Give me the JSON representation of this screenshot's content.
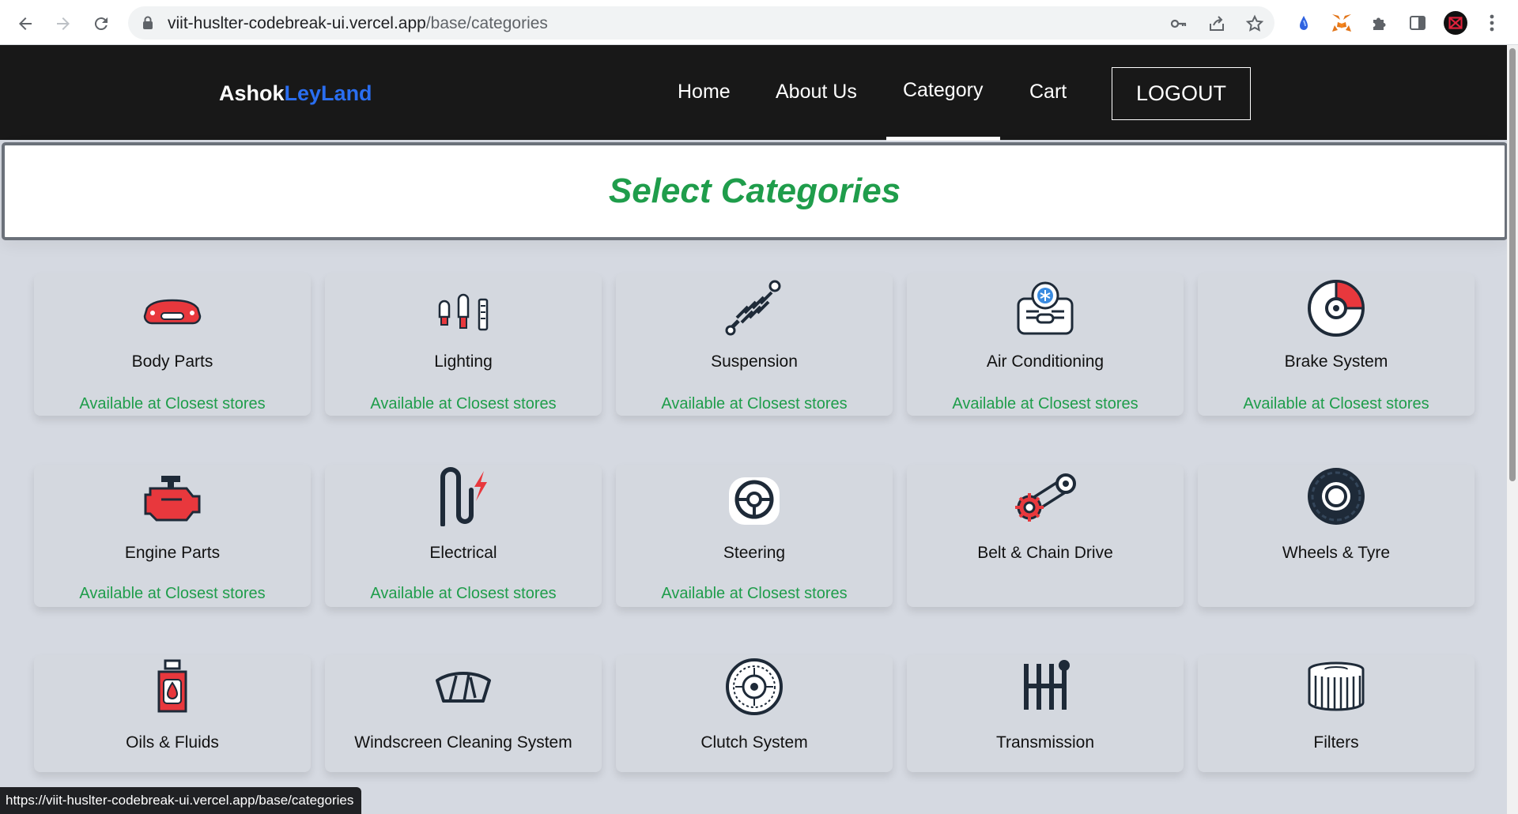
{
  "browser": {
    "url_host": "viit-huslter-codebreak-ui.vercel.app",
    "url_path": "/base/categories",
    "status_url": "https://viit-huslter-codebreak-ui.vercel.app/base/categories"
  },
  "header": {
    "brand_primary": "Ashok",
    "brand_accent": "LeyLand",
    "nav": [
      "Home",
      "About Us",
      "Category",
      "Cart"
    ],
    "active_nav": "Category",
    "logout_label": "LOGOUT"
  },
  "banner": {
    "title": "Select Categories"
  },
  "categories": [
    {
      "name": "Body Parts",
      "icon": "car-body-icon",
      "availability": "Available at Closest stores"
    },
    {
      "name": "Lighting",
      "icon": "bulb-icon",
      "availability": "Available at Closest stores"
    },
    {
      "name": "Suspension",
      "icon": "spring-icon",
      "availability": "Available at Closest stores"
    },
    {
      "name": "Air Conditioning",
      "icon": "ac-unit-icon",
      "availability": "Available at Closest stores"
    },
    {
      "name": "Brake System",
      "icon": "brake-disc-icon",
      "availability": "Available at Closest stores"
    },
    {
      "name": "Engine Parts",
      "icon": "engine-icon",
      "availability": "Available at Closest stores"
    },
    {
      "name": "Electrical",
      "icon": "electrical-icon",
      "availability": "Available at Closest stores"
    },
    {
      "name": "Steering",
      "icon": "steering-wheel-icon",
      "availability": "Available at Closest stores"
    },
    {
      "name": "Belt & Chain Drive",
      "icon": "belt-drive-icon",
      "availability": ""
    },
    {
      "name": "Wheels & Tyre",
      "icon": "tyre-icon",
      "availability": ""
    },
    {
      "name": "Oils & Fluids",
      "icon": "oil-bottle-icon",
      "availability": ""
    },
    {
      "name": "Windscreen Cleaning System",
      "icon": "wiper-icon",
      "availability": ""
    },
    {
      "name": "Clutch System",
      "icon": "clutch-icon",
      "availability": ""
    },
    {
      "name": "Transmission",
      "icon": "gear-shift-icon",
      "availability": ""
    },
    {
      "name": "Filters",
      "icon": "filter-icon",
      "availability": ""
    }
  ],
  "colors": {
    "header_bg": "#181818",
    "brand_accent": "#2a6ef0",
    "title_green": "#1f9d4b",
    "page_bg": "#d5d9e1",
    "icon_red": "#e8383d",
    "icon_dark": "#1e2a38"
  }
}
